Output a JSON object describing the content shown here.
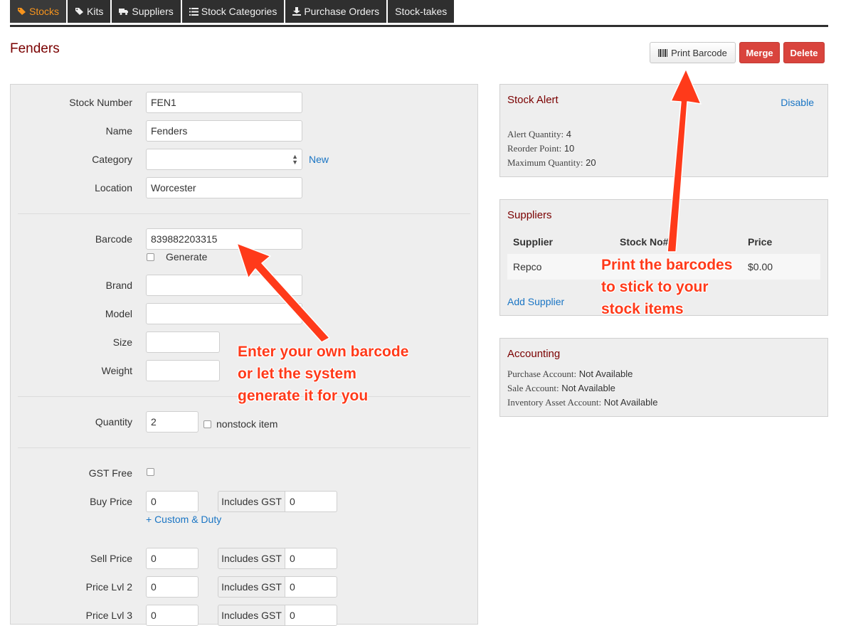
{
  "tabs": [
    {
      "label": "Stocks",
      "icon": "tags-icon",
      "active": true
    },
    {
      "label": "Kits",
      "icon": "tags-icon"
    },
    {
      "label": "Suppliers",
      "icon": "truck-icon"
    },
    {
      "label": "Stock Categories",
      "icon": "list-icon"
    },
    {
      "label": "Purchase Orders",
      "icon": "download-icon"
    },
    {
      "label": "Stock-takes"
    }
  ],
  "page": {
    "title": "Fenders"
  },
  "actions": {
    "print_barcode": "Print Barcode",
    "merge": "Merge",
    "delete": "Delete"
  },
  "form": {
    "stock_number": {
      "label": "Stock Number",
      "value": "FEN1"
    },
    "name": {
      "label": "Name",
      "value": "Fenders"
    },
    "category": {
      "label": "Category",
      "value": "",
      "new_link": "New"
    },
    "location": {
      "label": "Location",
      "value": "Worcester"
    },
    "barcode": {
      "label": "Barcode",
      "value": "839882203315",
      "generate_label": "Generate"
    },
    "brand": {
      "label": "Brand",
      "value": ""
    },
    "model": {
      "label": "Model",
      "value": ""
    },
    "size": {
      "label": "Size",
      "value": ""
    },
    "weight": {
      "label": "Weight",
      "value": ""
    },
    "quantity": {
      "label": "Quantity",
      "value": "2",
      "nonstock_label": "nonstock item"
    },
    "gst_free": {
      "label": "GST Free"
    },
    "buy_price": {
      "label": "Buy Price",
      "value": "0",
      "incl_label": "Includes GST",
      "incl_value": "0",
      "custom_link": "+ Custom & Duty"
    },
    "sell_price": {
      "label": "Sell Price",
      "value": "0",
      "incl_label": "Includes GST",
      "incl_value": "0"
    },
    "price_lvl2": {
      "label": "Price Lvl 2",
      "value": "0",
      "incl_label": "Includes GST",
      "incl_value": "0"
    },
    "price_lvl3": {
      "label": "Price Lvl 3",
      "value": "0",
      "incl_label": "Includes GST",
      "incl_value": "0"
    }
  },
  "stock_alert": {
    "title": "Stock Alert",
    "disable": "Disable",
    "alert_qty_label": "Alert Quantity:",
    "alert_qty": "4",
    "reorder_label": "Reorder Point:",
    "reorder": "10",
    "max_label": "Maximum Quantity:",
    "max": "20"
  },
  "suppliers": {
    "title": "Suppliers",
    "headers": [
      "Supplier",
      "Stock No#",
      "Price"
    ],
    "rows": [
      {
        "supplier": "Repco",
        "stock_no": "",
        "price": "$0.00"
      }
    ],
    "add_link": "Add Supplier"
  },
  "accounting": {
    "title": "Accounting",
    "purchase_label": "Purchase Account:",
    "purchase": "Not Available",
    "sale_label": "Sale Account:",
    "sale": "Not Available",
    "inventory_label": "Inventory Asset Account:",
    "inventory": "Not Available"
  },
  "annotations": {
    "barcode_lines": [
      "Enter your own barcode",
      "or let the system",
      "generate it for you"
    ],
    "print_lines": [
      "Print the barcodes",
      "to stick to your",
      "stock items"
    ]
  },
  "colors": {
    "accent_tab": "#f7941d",
    "danger": "#d9443d",
    "link": "#1a75c4",
    "title": "#7a0000",
    "annotation": "#ff3a1a"
  }
}
